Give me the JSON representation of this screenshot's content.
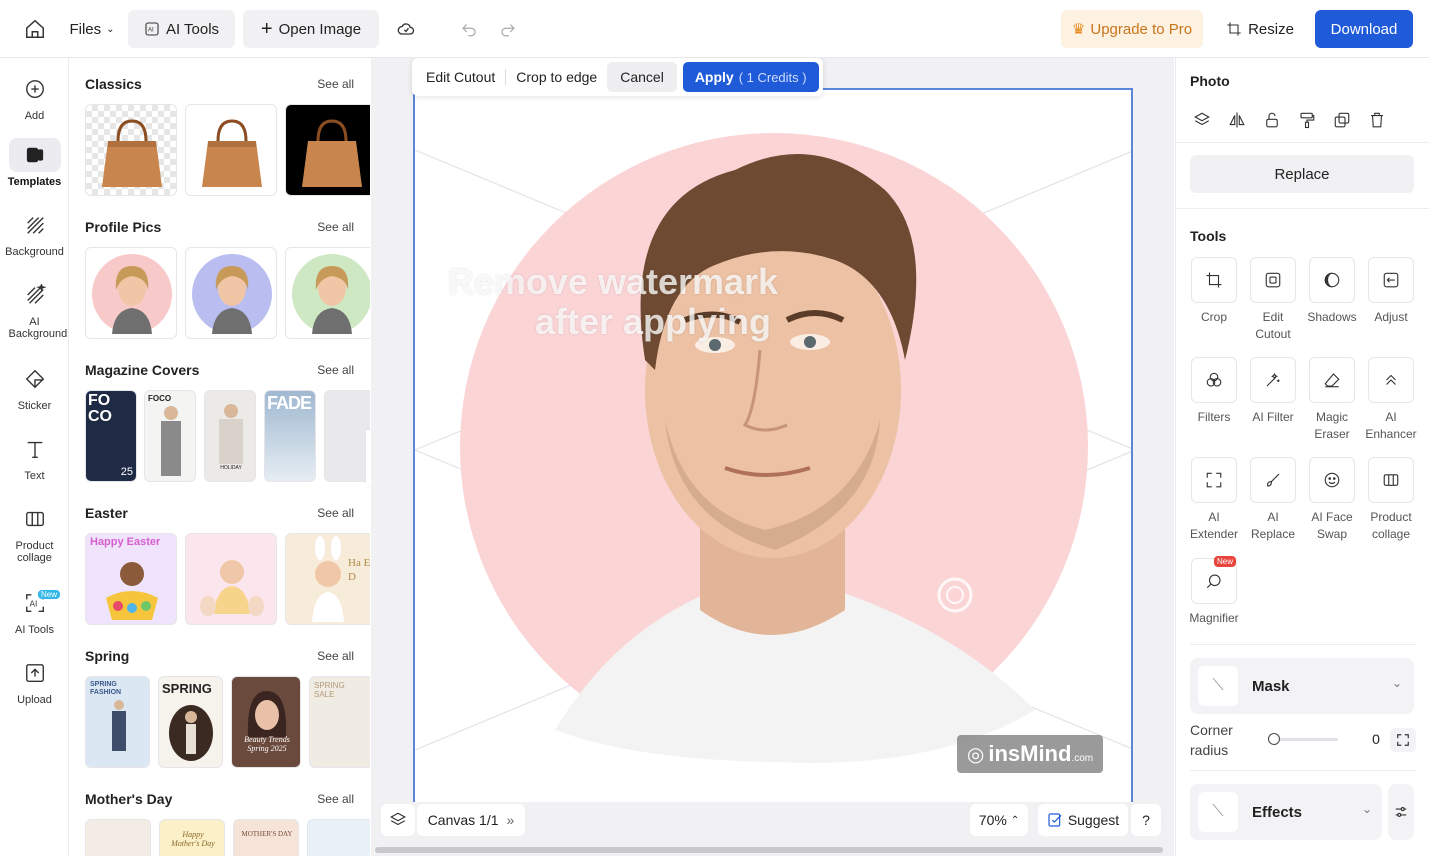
{
  "topbar": {
    "files": "Files",
    "ai_tools": "AI Tools",
    "open_image": "Open Image",
    "upgrade": "Upgrade to Pro",
    "resize": "Resize",
    "download": "Download"
  },
  "rail": {
    "items": [
      {
        "label": "Add",
        "icon": "plus-circle-icon"
      },
      {
        "label": "Templates",
        "icon": "templates-icon"
      },
      {
        "label": "Background",
        "icon": "hatch-icon"
      },
      {
        "label": "AI Background",
        "icon": "ai-hatch-icon"
      },
      {
        "label": "Sticker",
        "icon": "sticker-icon"
      },
      {
        "label": "Text",
        "icon": "text-icon"
      },
      {
        "label": "Product collage",
        "icon": "collage-icon"
      },
      {
        "label": "AI Tools",
        "icon": "ai-tools-icon",
        "badge": "New"
      },
      {
        "label": "Upload",
        "icon": "upload-icon"
      }
    ]
  },
  "templates": {
    "see_all": "See all",
    "sections": [
      {
        "title": "Classics"
      },
      {
        "title": "Profile Pics"
      },
      {
        "title": "Magazine Covers"
      },
      {
        "title": "Easter"
      },
      {
        "title": "Spring"
      },
      {
        "title": "Mother's Day"
      }
    ],
    "magazine": {
      "cover1_big": "FO CO",
      "cover1_num": "25",
      "cover2": "FOCO",
      "cover3": "HOLIDAY",
      "cover4": "FADE"
    },
    "easter": {
      "card1": "Happy Easter",
      "card3": "Ha Ea D"
    },
    "spring": {
      "card1": "SPRING FASHION",
      "card2": "SPRING",
      "card3": "Beauty Trends Spring 2025",
      "card4": "SPRING SALE"
    },
    "mothers": {
      "card2": "Happy Mother's Day",
      "card3": "MOTHER'S DAY"
    }
  },
  "cutout_bar": {
    "edit_cutout": "Edit Cutout",
    "crop_to_edge": "Crop to edge",
    "cancel": "Cancel",
    "apply": "Apply",
    "credits": "( 1 Credits )"
  },
  "canvas": {
    "watermark_line1": "Remove watermark",
    "watermark_line2": "after applying",
    "brand": "insMind",
    "brand_suffix": ".com"
  },
  "bottombar": {
    "canvas_label": "Canvas 1/1",
    "zoom": "70%",
    "suggest": "Suggest",
    "help": "?"
  },
  "right_panel": {
    "title": "Photo",
    "replace": "Replace",
    "tools_title": "Tools",
    "tools": [
      {
        "label": "Crop"
      },
      {
        "label": "Edit Cutout"
      },
      {
        "label": "Shadows"
      },
      {
        "label": "Adjust"
      },
      {
        "label": "Filters"
      },
      {
        "label": "AI Filter"
      },
      {
        "label": "Magic Eraser"
      },
      {
        "label": "AI Enhancer"
      },
      {
        "label": "AI Extender"
      },
      {
        "label": "AI Replace"
      },
      {
        "label": "AI Face Swap"
      },
      {
        "label": "Product collage"
      },
      {
        "label": "Magnifier",
        "badge": "New"
      }
    ],
    "mask": "Mask",
    "corner_radius": "Corner radius",
    "corner_value": "0",
    "effects": "Effects"
  },
  "colors": {
    "primary": "#1f5bd8",
    "upgrade_bg": "#fdf1e2",
    "upgrade_text": "#c8761b",
    "pink_circle": "#fbd4d6"
  }
}
